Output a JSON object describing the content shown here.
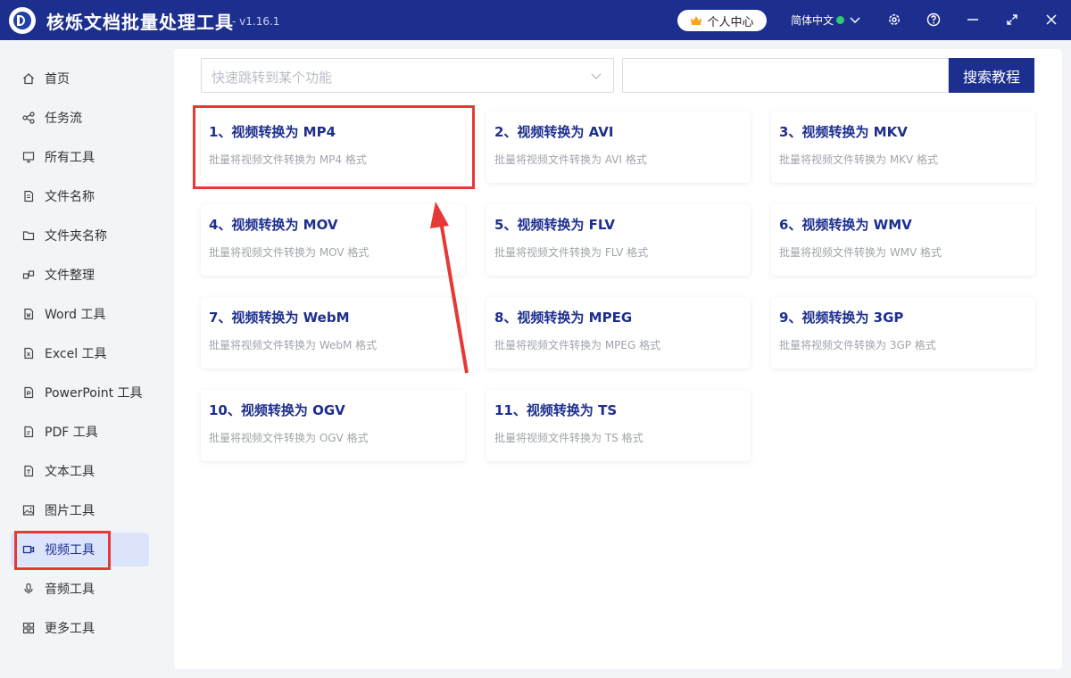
{
  "app": {
    "title": "核烁文档批量处理工具",
    "version": "- v1.16.1",
    "user_center": "个人中心",
    "language": "简体中文"
  },
  "sidebar": {
    "items": [
      {
        "label": "首页",
        "icon": "home-icon"
      },
      {
        "label": "任务流",
        "icon": "workflow-icon"
      },
      {
        "label": "所有工具",
        "icon": "monitor-icon"
      },
      {
        "label": "文件名称",
        "icon": "file-icon"
      },
      {
        "label": "文件夹名称",
        "icon": "folder-icon"
      },
      {
        "label": "文件整理",
        "icon": "organize-icon"
      },
      {
        "label": "Word 工具",
        "icon": "word-icon"
      },
      {
        "label": "Excel 工具",
        "icon": "excel-icon"
      },
      {
        "label": "PowerPoint 工具",
        "icon": "powerpoint-icon"
      },
      {
        "label": "PDF 工具",
        "icon": "pdf-icon"
      },
      {
        "label": "文本工具",
        "icon": "text-icon"
      },
      {
        "label": "图片工具",
        "icon": "image-icon"
      },
      {
        "label": "视频工具",
        "icon": "video-icon",
        "active": true
      },
      {
        "label": "音频工具",
        "icon": "microphone-icon"
      },
      {
        "label": "更多工具",
        "icon": "grid-icon"
      }
    ]
  },
  "search": {
    "jump_placeholder": "快速跳转到某个功能",
    "button_label": "搜索教程"
  },
  "cards": [
    {
      "title": "1、视频转换为 MP4",
      "desc": "批量将视频文件转换为 MP4 格式"
    },
    {
      "title": "2、视频转换为 AVI",
      "desc": "批量将视频文件转换为 AVI 格式"
    },
    {
      "title": "3、视频转换为 MKV",
      "desc": "批量将视频文件转换为 MKV 格式"
    },
    {
      "title": "4、视频转换为 MOV",
      "desc": "批量将视频文件转换为 MOV 格式"
    },
    {
      "title": "5、视频转换为 FLV",
      "desc": "批量将视频文件转换为 FLV 格式"
    },
    {
      "title": "6、视频转换为 WMV",
      "desc": "批量将视频文件转换为 WMV 格式"
    },
    {
      "title": "7、视频转换为 WebM",
      "desc": "批量将视频文件转换为 WebM 格式"
    },
    {
      "title": "8、视频转换为 MPEG",
      "desc": "批量将视频文件转换为 MPEG 格式"
    },
    {
      "title": "9、视频转换为 3GP",
      "desc": "批量将视频文件转换为 3GP 格式"
    },
    {
      "title": "10、视频转换为 OGV",
      "desc": "批量将视频文件转换为 OGV 格式"
    },
    {
      "title": "11、视频转换为 TS",
      "desc": "批量将视频文件转换为 TS 格式"
    }
  ],
  "colors": {
    "brand": "#1d2f8e",
    "highlight": "#e53935",
    "active_bg": "#dce4fb"
  }
}
